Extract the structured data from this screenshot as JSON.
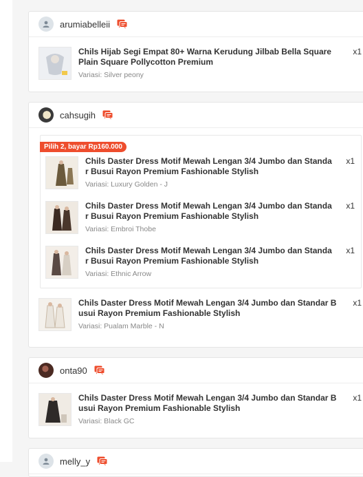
{
  "orders": [
    {
      "username": "arumiabelleii",
      "items": [
        {
          "title": "Chils Hijab Segi Empat 80+ Warna Kerudung Jilbab Bella Square Plain Square Pollycotton Premium",
          "variant": "Variasi: Silver peony",
          "qty": "x1"
        }
      ]
    },
    {
      "username": "cahsugih",
      "bundle_label": "Pilih 2, bayar Rp160.000",
      "bundle_items": [
        {
          "title": "Chils Daster Dress Motif Mewah Lengan 3/4 Jumbo dan Standar Busui Rayon Premium Fashionable Stylish",
          "variant": "Variasi: Luxury Golden - J",
          "qty": "x1"
        },
        {
          "title": "Chils Daster Dress Motif Mewah Lengan 3/4 Jumbo dan Standar Busui Rayon Premium Fashionable Stylish",
          "variant": "Variasi: Embroi Thobe",
          "qty": "x1"
        },
        {
          "title": "Chils Daster Dress Motif Mewah Lengan 3/4 Jumbo dan Standar Busui Rayon Premium Fashionable Stylish",
          "variant": "Variasi: Ethnic Arrow",
          "qty": "x1"
        }
      ],
      "items": [
        {
          "title": "Chils Daster Dress Motif Mewah Lengan 3/4 Jumbo dan Standar Busui Rayon Premium Fashionable Stylish",
          "variant": "Variasi: Pualam Marble - N",
          "qty": "x1"
        }
      ]
    },
    {
      "username": "onta90",
      "items": [
        {
          "title": "Chils Daster Dress Motif Mewah Lengan 3/4 Jumbo dan Standar Busui Rayon Premium Fashionable Stylish",
          "variant": "Variasi: Black GC",
          "qty": "x1"
        }
      ]
    },
    {
      "username": "melly_y"
    }
  ],
  "colors": {
    "accent": "#ee4d2d",
    "muted": "#888888"
  },
  "icons": {
    "chat": "chat-icon",
    "default_avatar": "user-icon"
  }
}
